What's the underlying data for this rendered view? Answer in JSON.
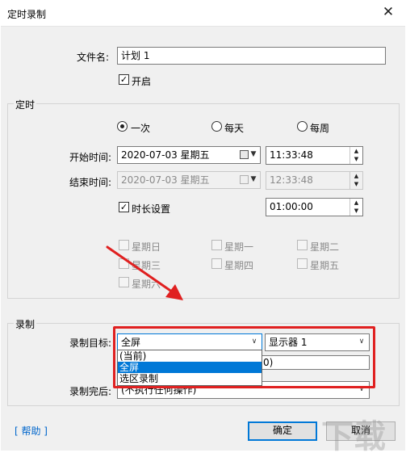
{
  "window": {
    "title": "定时录制",
    "close_label": "✕"
  },
  "filename": {
    "label": "文件名:",
    "value": "计划 1"
  },
  "enable": {
    "label": "开启",
    "checked": true
  },
  "timer": {
    "group_title": "定时",
    "modes": [
      {
        "label": "一次",
        "selected": true
      },
      {
        "label": "每天",
        "selected": false
      },
      {
        "label": "每周",
        "selected": false
      }
    ],
    "start": {
      "label": "开始时间:",
      "date": "2020-07-03 星期五",
      "time": "11:33:48"
    },
    "end": {
      "label": "结束时间:",
      "date": "2020-07-03 星期五",
      "time": "12:33:48"
    },
    "duration": {
      "label": "时长设置",
      "checked": true,
      "value": "01:00:00"
    },
    "weekdays": [
      "星期日",
      "星期一",
      "星期二",
      "星期三",
      "星期四",
      "星期五",
      "星期六"
    ]
  },
  "record": {
    "group_title": "录制",
    "target_label": "录制目标:",
    "target_value": "全屏",
    "monitor_value": "显示器 1",
    "options": [
      "(当前)",
      "全屏",
      "选区录制"
    ],
    "selected_option": "全屏",
    "behind_fragment": "0)",
    "finish_label": "录制完后:",
    "finish_value": "(不执行任何操作)"
  },
  "footer": {
    "help": "[ 帮助 ]",
    "ok": "确定",
    "cancel": "取消"
  },
  "colors": {
    "highlight": "#e02020",
    "arrow": "#e02020",
    "selection": "#0078d7"
  },
  "icons": {
    "calendar": "calendar-icon",
    "dropdown": "chevron-down-icon",
    "spin_up": "arrow-up-icon",
    "spin_down": "arrow-down-icon"
  }
}
